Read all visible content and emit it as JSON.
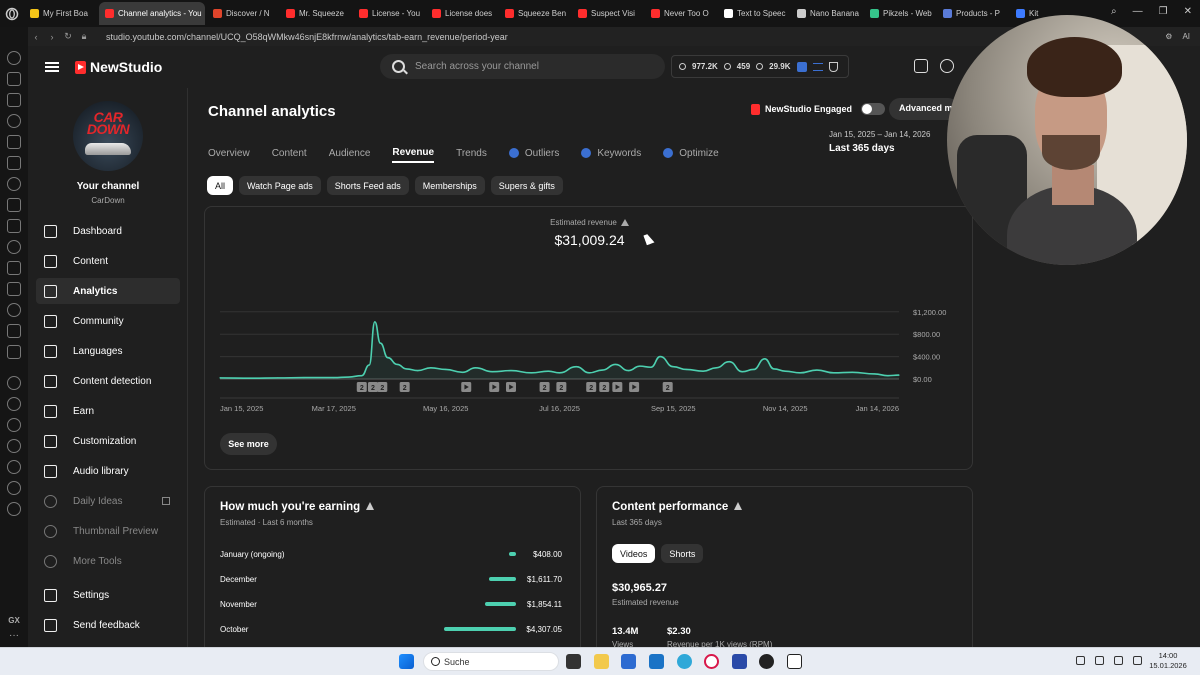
{
  "browser": {
    "tabs": [
      {
        "label": "My First Boa",
        "color": "#f5c518"
      },
      {
        "label": "Channel analytics - You",
        "color": "#ff2d2d",
        "active": true
      },
      {
        "label": "Discover / N",
        "color": "#e0452b"
      },
      {
        "label": "Mr. Squeeze",
        "color": "#ff2d2d"
      },
      {
        "label": "License - You",
        "color": "#ff2d2d"
      },
      {
        "label": "License does",
        "color": "#ff2d2d"
      },
      {
        "label": "Squeeze Ben",
        "color": "#ff2d2d"
      },
      {
        "label": "Suspect Visi",
        "color": "#ff2d2d"
      },
      {
        "label": "Never Too O",
        "color": "#ff2d2d"
      },
      {
        "label": "Text to Speec",
        "color": "#ffffff"
      },
      {
        "label": "Nano Banana",
        "color": "#cccccc"
      },
      {
        "label": "Pikzels - Web",
        "color": "#35c48a"
      },
      {
        "label": "Products - P",
        "color": "#5a7bd8"
      },
      {
        "label": "Kit",
        "color": "#3d7bff"
      }
    ],
    "url": "studio.youtube.com/channel/UCQ_O58qWMkw46snjE8kfrnw/analytics/tab-earn_revenue/period-year",
    "ai_label": "AI"
  },
  "header": {
    "brand": "NewStudio",
    "search_placeholder": "Search across your channel",
    "stat_subs": "977.2K",
    "stat_videos": "459",
    "stat_views": "29.9K"
  },
  "channel": {
    "avatar_text_top": "CAR",
    "avatar_text_bottom": "DOWN",
    "title": "Your channel",
    "handle": "CarDown"
  },
  "nav": [
    {
      "label": "Dashboard",
      "icon": "grid-icon"
    },
    {
      "label": "Content",
      "icon": "video-icon"
    },
    {
      "label": "Analytics",
      "icon": "bar-chart-icon",
      "active": true
    },
    {
      "label": "Community",
      "icon": "people-icon"
    },
    {
      "label": "Languages",
      "icon": "subtitles-icon"
    },
    {
      "label": "Content detection",
      "icon": "copyright-icon"
    },
    {
      "label": "Earn",
      "icon": "dollar-icon"
    },
    {
      "label": "Customization",
      "icon": "magic-wand-icon"
    },
    {
      "label": "Audio library",
      "icon": "music-icon"
    },
    {
      "label": "Daily Ideas",
      "icon": "lightbulb-icon",
      "dim": true
    },
    {
      "label": "Thumbnail Preview",
      "icon": "image-icon",
      "dim": true
    },
    {
      "label": "More Tools",
      "icon": "tools-icon",
      "dim": true
    },
    {
      "label": "Settings",
      "icon": "gear-icon"
    },
    {
      "label": "Send feedback",
      "icon": "feedback-icon"
    }
  ],
  "page": {
    "title": "Channel analytics",
    "engaged_label": "NewStudio Engaged",
    "advanced_label": "Advanced mo",
    "date_range": "Jan 15, 2025 – Jan 14, 2026",
    "period": "Last 365 days",
    "tabs": [
      {
        "label": "Overview"
      },
      {
        "label": "Content"
      },
      {
        "label": "Audience"
      },
      {
        "label": "Revenue",
        "active": true
      },
      {
        "label": "Trends"
      },
      {
        "label": "Outliers",
        "icon": true
      },
      {
        "label": "Keywords",
        "icon": true
      },
      {
        "label": "Optimize",
        "icon": true
      }
    ],
    "chips": [
      {
        "label": "All",
        "active": true
      },
      {
        "label": "Watch Page ads"
      },
      {
        "label": "Shorts Feed ads"
      },
      {
        "label": "Memberships"
      },
      {
        "label": "Supers & gifts"
      }
    ]
  },
  "revenue": {
    "label": "Estimated revenue",
    "value": "$31,009.24",
    "see_more": "See more"
  },
  "chart_data": {
    "type": "line",
    "title": "Estimated revenue",
    "x_ticks": [
      "Jan 15, 2025",
      "Mar 17, 2025",
      "May 16, 2025",
      "Jul 16, 2025",
      "Sep 15, 2025",
      "Nov 14, 2025",
      "Jan 14, 2026"
    ],
    "y_ticks": [
      "$0.00",
      "$400.00",
      "$800.00",
      "$1,200.00"
    ],
    "ylim": [
      0,
      1250
    ],
    "series": [
      {
        "color": "#4dd0b0",
        "x": [
          "2025-01-15",
          "2025-02-01",
          "2025-02-15",
          "2025-03-01",
          "2025-03-17",
          "2025-03-25",
          "2025-04-01",
          "2025-04-05",
          "2025-04-08",
          "2025-04-11",
          "2025-04-15",
          "2025-04-20",
          "2025-04-25",
          "2025-05-01",
          "2025-05-08",
          "2025-05-16",
          "2025-05-25",
          "2025-06-01",
          "2025-06-10",
          "2025-06-20",
          "2025-07-01",
          "2025-07-10",
          "2025-07-16",
          "2025-07-25",
          "2025-08-01",
          "2025-08-08",
          "2025-08-15",
          "2025-08-22",
          "2025-08-28",
          "2025-09-03",
          "2025-09-08",
          "2025-09-15",
          "2025-09-22",
          "2025-10-01",
          "2025-10-08",
          "2025-10-15",
          "2025-10-22",
          "2025-10-28",
          "2025-11-03",
          "2025-11-08",
          "2025-11-14",
          "2025-11-22",
          "2025-12-01",
          "2025-12-10",
          "2025-12-20",
          "2026-01-01",
          "2026-01-08",
          "2026-01-14"
        ],
        "values": [
          20,
          15,
          20,
          25,
          25,
          35,
          60,
          250,
          1020,
          640,
          380,
          260,
          180,
          150,
          200,
          170,
          120,
          200,
          130,
          150,
          110,
          140,
          110,
          220,
          110,
          160,
          260,
          150,
          230,
          210,
          400,
          220,
          170,
          140,
          200,
          310,
          130,
          170,
          360,
          180,
          140,
          110,
          160,
          110,
          120,
          90,
          60,
          70
        ]
      }
    ],
    "markers": [
      {
        "date": "2025-04-01",
        "type": "short",
        "text": "2"
      },
      {
        "date": "2025-04-07",
        "type": "short",
        "text": "2"
      },
      {
        "date": "2025-04-12",
        "type": "short",
        "text": "2"
      },
      {
        "date": "2025-04-24",
        "type": "short",
        "text": "2"
      },
      {
        "date": "2025-05-27",
        "type": "play"
      },
      {
        "date": "2025-06-11",
        "type": "play"
      },
      {
        "date": "2025-06-20",
        "type": "play"
      },
      {
        "date": "2025-07-08",
        "type": "short",
        "text": "2"
      },
      {
        "date": "2025-07-17",
        "type": "short",
        "text": "2"
      },
      {
        "date": "2025-08-02",
        "type": "short",
        "text": "2"
      },
      {
        "date": "2025-08-09",
        "type": "short",
        "text": "2"
      },
      {
        "date": "2025-08-16",
        "type": "play"
      },
      {
        "date": "2025-08-25",
        "type": "play"
      },
      {
        "date": "2025-09-12",
        "type": "short",
        "text": "2"
      }
    ]
  },
  "earning": {
    "title": "How much you're earning",
    "subtitle": "Estimated · Last 6 months",
    "rows": [
      {
        "month": "January (ongoing)",
        "value": "$408.00",
        "amount": 408
      },
      {
        "month": "December",
        "value": "$1,611.70",
        "amount": 1611.7
      },
      {
        "month": "November",
        "value": "$1,854.11",
        "amount": 1854.11
      },
      {
        "month": "October",
        "value": "$4,307.05",
        "amount": 4307.05
      }
    ]
  },
  "performance": {
    "title": "Content performance",
    "subtitle": "Last 365 days",
    "tabs": [
      {
        "label": "Videos",
        "active": true
      },
      {
        "label": "Shorts"
      }
    ],
    "value": "$30,965.27",
    "value_label": "Estimated revenue",
    "views_value": "13.4M",
    "views_label": "Views",
    "rpm_value": "$2.30",
    "rpm_label": "Revenue per 1K views (RPM)"
  },
  "taskbar": {
    "search": "Suche",
    "time": "14:00",
    "date": "15.01.2026"
  }
}
